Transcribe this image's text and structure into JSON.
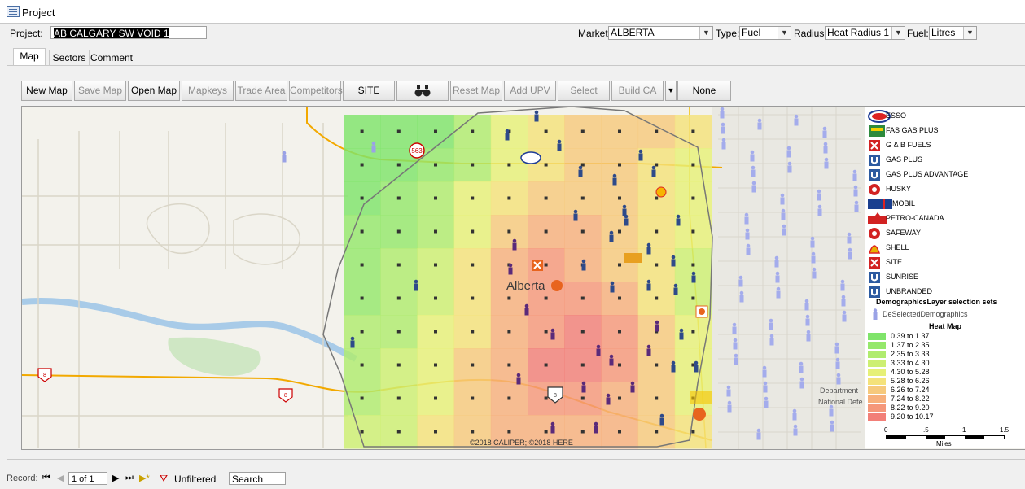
{
  "window": {
    "title": "Project"
  },
  "form": {
    "project_label": "Project:",
    "project_value": "AB CALGARY SW VOID 1",
    "market_label": "Market:",
    "market_value": "ALBERTA",
    "type_label": "Type:",
    "type_value": "Fuel",
    "radius_label": "Radius:",
    "radius_value": "Heat Radius 1",
    "fuel_label": "Fuel:",
    "fuel_value": "Litres"
  },
  "tabs": [
    {
      "label": "Map",
      "active": true
    },
    {
      "label": "Sectors",
      "active": false
    },
    {
      "label": "Comment",
      "active": false
    }
  ],
  "toolbar": {
    "new_map": "New Map",
    "save_map": "Save Map",
    "open_map": "Open Map",
    "mapkeys": "Mapkeys",
    "trade_area": "Trade Area",
    "competitors": "Competitors",
    "site": "SITE",
    "binoculars_icon": "binoculars-icon",
    "reset_map": "Reset Map",
    "add_upv": "Add UPV",
    "select": "Select",
    "build_ca": "Build CA",
    "none": "None"
  },
  "map": {
    "city_label": "Alberta",
    "copyright": "©2018 CALIPER; ©2018 HERE",
    "dnd_label_1": "Department",
    "dnd_label_2": "National Defe",
    "route_8": "8",
    "route_563": "563"
  },
  "legend": {
    "brands": [
      {
        "name": "ESSO",
        "icon": "esso-icon",
        "color": "#1e3c96"
      },
      {
        "name": "FAS GAS PLUS",
        "icon": "fasgas-icon",
        "color": "#2e8b3d"
      },
      {
        "name": "G & B FUELS",
        "icon": "x-icon",
        "color": "#d22222"
      },
      {
        "name": "GAS PLUS",
        "icon": "u-icon",
        "color": "#2c5aa0"
      },
      {
        "name": "GAS PLUS ADVANTAGE",
        "icon": "u-icon",
        "color": "#2c5aa0"
      },
      {
        "name": "HUSKY",
        "icon": "husky-icon",
        "color": "#d22222"
      },
      {
        "name": "MOBIL",
        "icon": "mobil-logo",
        "color": "#1a3f8f"
      },
      {
        "name": "PETRO-CANADA",
        "icon": "petrocanada-icon",
        "color": "#d22222"
      },
      {
        "name": "SAFEWAY",
        "icon": "safeway-icon",
        "color": "#d22222"
      },
      {
        "name": "SHELL",
        "icon": "shell-icon",
        "color": "#e8b000"
      },
      {
        "name": "SITE",
        "icon": "x-icon",
        "color": "#d22222"
      },
      {
        "name": "SUNRISE",
        "icon": "u-icon",
        "color": "#2c5aa0"
      },
      {
        "name": "UNBRANDED",
        "icon": "u-icon",
        "color": "#2c5aa0"
      }
    ],
    "demo_title": "DemographicsLayer selection sets",
    "demo_item": "DeSelectedDemographics",
    "heat_title": "Heat Map",
    "heat_ranges": [
      {
        "label": "0.39 to 1.37",
        "color": "#7fe46a"
      },
      {
        "label": "1.37 to 2.35",
        "color": "#95e86b"
      },
      {
        "label": "2.35 to 3.33",
        "color": "#b0ec6e"
      },
      {
        "label": "3.33 to 4.30",
        "color": "#cdef72"
      },
      {
        "label": "4.30 to 5.28",
        "color": "#e6f077"
      },
      {
        "label": "5.28 to 6.26",
        "color": "#f4e27a"
      },
      {
        "label": "6.26 to 7.24",
        "color": "#f6c97c"
      },
      {
        "label": "7.24 to 8.22",
        "color": "#f7b07c"
      },
      {
        "label": "8.22 to 9.20",
        "color": "#f5977a"
      },
      {
        "label": "9.20 to 10.17",
        "color": "#f27f78"
      }
    ],
    "scale_ticks": [
      "0",
      ".5",
      "1",
      "1.5"
    ],
    "scale_unit": "Miles"
  },
  "status": {
    "record_label": "Record:",
    "record_value": "1 of 1",
    "filter_label": "Unfiltered",
    "search_label": "Search"
  }
}
